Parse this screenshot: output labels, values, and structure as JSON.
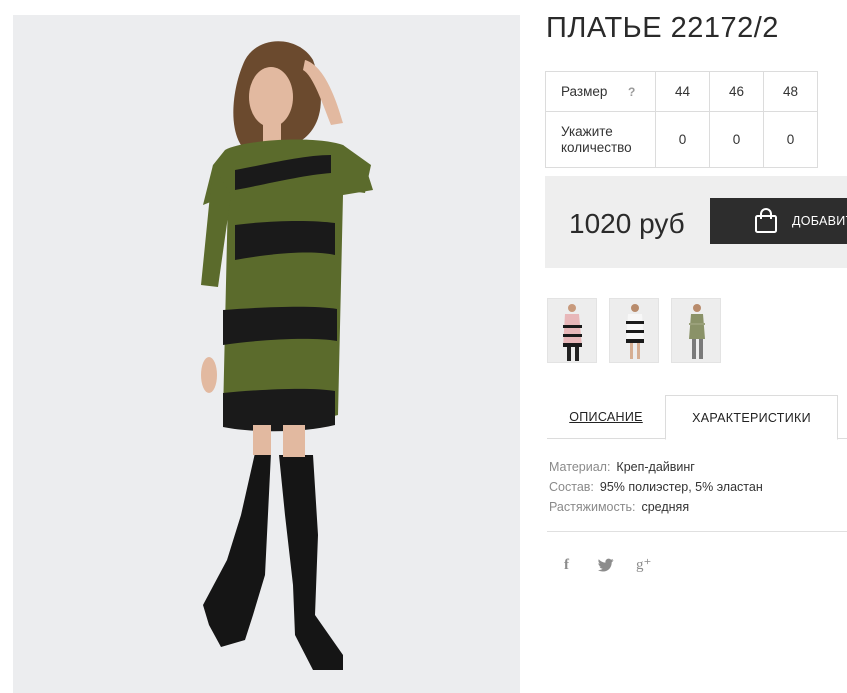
{
  "product": {
    "title": "ПЛАТЬЕ 22172/2",
    "photo_icon": "dress-photo",
    "colors": {
      "dress": "#5b6b2c",
      "lace": "#1a1a1a",
      "background": "#ecedef"
    }
  },
  "sizes": {
    "label": "Размер",
    "help": "?",
    "qty_label": "Укажите количество",
    "values": [
      "44",
      "46",
      "48"
    ],
    "quantities": [
      "0",
      "0",
      "0"
    ]
  },
  "price": {
    "amount": "1020 руб",
    "cart_label": "ДОБАВИТЬ",
    "cart_icon": "shopping-bag-icon",
    "colors": {
      "box": "#eeeeee",
      "button": "#2d2d2d"
    }
  },
  "thumbnails": [
    {
      "name": "pink-dress-thumb",
      "color": "#e8b7b9"
    },
    {
      "name": "white-dress-thumb",
      "color": "#f4f4f4"
    },
    {
      "name": "green-dress-thumb",
      "color": "#8a9268"
    }
  ],
  "tabs": [
    {
      "label": "ОПИСАНИЕ"
    },
    {
      "label": "ХАРАКТЕРИСТИКИ"
    }
  ],
  "specs": [
    {
      "key": "Материал:",
      "value": "Креп-дайвинг"
    },
    {
      "key": "Состав:",
      "value": "95% полиэстер, 5% эластан"
    },
    {
      "key": "Растяжимость:",
      "value": "средняя"
    }
  ],
  "social": {
    "facebook": "f",
    "twitter": "🐦",
    "google": "g⁺"
  }
}
